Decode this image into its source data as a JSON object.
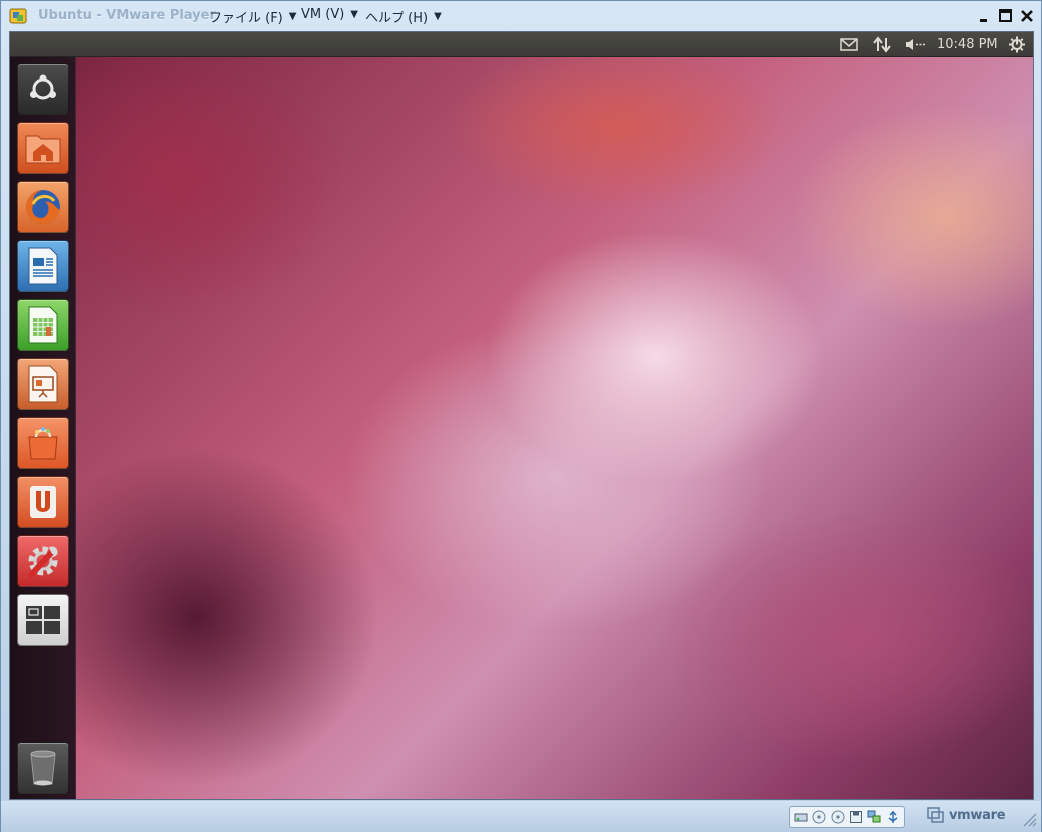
{
  "window": {
    "title": "Ubuntu - VMware Player",
    "menus": [
      {
        "label": "ファイル (F)"
      },
      {
        "label": "VM (V)"
      },
      {
        "label": "ヘルプ (H)"
      }
    ],
    "controls": [
      "minimize",
      "maximize",
      "close"
    ]
  },
  "guest": {
    "top_panel": {
      "clock": "10:48 PM",
      "indicators": [
        "mail-icon",
        "network-icon",
        "sound-icon",
        "gear-icon"
      ]
    },
    "launcher": {
      "items": [
        {
          "name": "dash",
          "icon": "ubuntu-logo-icon"
        },
        {
          "name": "home-folder",
          "icon": "home-folder-icon"
        },
        {
          "name": "firefox",
          "icon": "firefox-icon"
        },
        {
          "name": "libreoffice-writer",
          "icon": "writer-icon"
        },
        {
          "name": "libreoffice-calc",
          "icon": "calc-icon"
        },
        {
          "name": "libreoffice-impress",
          "icon": "impress-icon"
        },
        {
          "name": "ubuntu-software-center",
          "icon": "shopping-bag-icon"
        },
        {
          "name": "ubuntu-one",
          "icon": "ubuntu-one-icon"
        },
        {
          "name": "system-settings",
          "icon": "settings-icon"
        },
        {
          "name": "workspace-switcher",
          "icon": "workspace-icon"
        },
        {
          "name": "trash",
          "icon": "trash-icon"
        }
      ]
    }
  },
  "statusbar": {
    "devices": [
      "hard-disk-icon",
      "cd-icon",
      "cd-icon",
      "floppy-icon",
      "network-adapter-icon",
      "usb-icon"
    ],
    "brand": "vmware"
  },
  "colors": {
    "launcher_bg": "#2a1622",
    "panel_bg": "#3b3a36",
    "ubuntu_orange": "#dd4814",
    "frame_blue": "#b9cfe6"
  }
}
